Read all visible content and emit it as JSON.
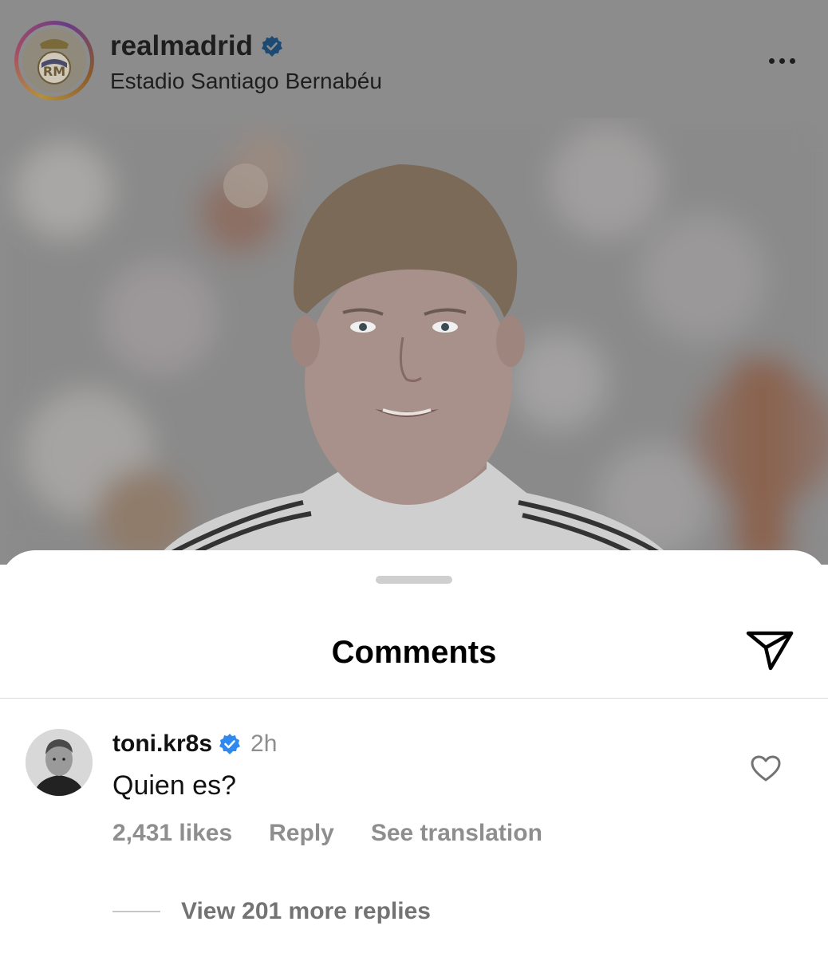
{
  "post": {
    "username": "realmadrid",
    "location": "Estadio Santiago Bernabéu",
    "verified_color": "#0095f6"
  },
  "sheet": {
    "title": "Comments"
  },
  "comment": {
    "username": "toni.kr8s",
    "time": "2h",
    "text": "Quien es?",
    "likes": "2,431 likes",
    "reply": "Reply",
    "translate": "See translation",
    "view_replies": "View 201 more replies"
  },
  "icons": {
    "verified": "verified-badge-icon",
    "more": "more-dots-icon",
    "send": "send-paper-plane-icon",
    "heart": "heart-outline-icon"
  }
}
